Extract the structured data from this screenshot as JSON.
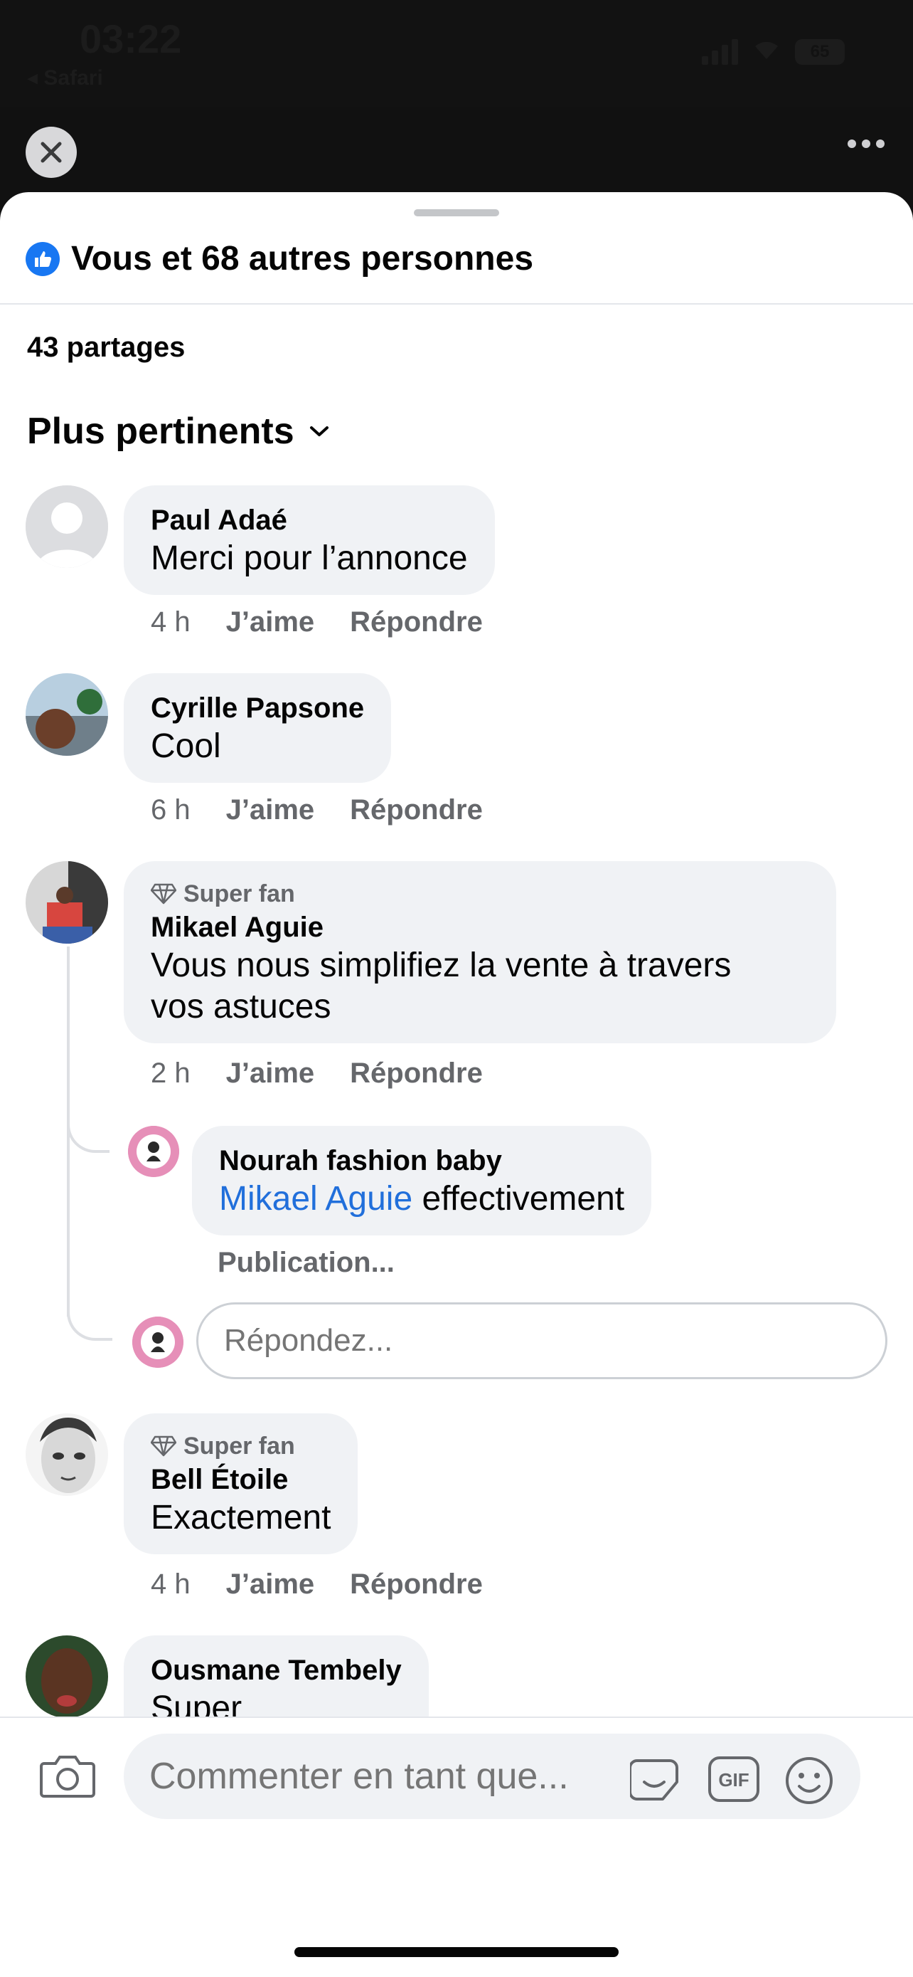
{
  "status_bar": {
    "time": "03:22",
    "back_app": "◂ Safari",
    "battery": "65"
  },
  "header": {
    "close_icon": "close-icon",
    "more_icon": "more-icon"
  },
  "sheet": {
    "reactions": "Vous et 68 autres personnes",
    "shares": "43 partages",
    "sort": "Plus pertinents"
  },
  "comments": [
    {
      "author": "Paul Adaé",
      "text": "Merci pour l’annonce",
      "time": "4 h",
      "like": "J’aime",
      "reply": "Répondre"
    },
    {
      "author": "Cyrille Papsone",
      "text": "Cool",
      "time": "6 h",
      "like": "J’aime",
      "reply": "Répondre"
    },
    {
      "badge": "Super fan",
      "author": "Mikael Aguie",
      "text_line1": "Vous nous simplifiez la vente à travers",
      "text_line2": "vos astuces",
      "time": "2 h",
      "like": "J’aime",
      "reply": "Répondre",
      "reply_item": {
        "author": "Nourah fashion baby",
        "mention": "Mikael Aguie",
        "text": " effectivement",
        "status": "Publication..."
      },
      "reply_placeholder": "Répondez..."
    },
    {
      "badge": "Super fan",
      "author": "Bell Étoile",
      "text": "Exactement",
      "time": "4 h",
      "like": "J’aime",
      "reply": "Répondre"
    },
    {
      "author": "Ousmane Tembely",
      "text": "Super"
    }
  ],
  "composer": {
    "placeholder": "Commenter en tant que...",
    "gif_label": "GIF"
  },
  "colors": {
    "accent": "#1877f2",
    "mention": "#216fdb",
    "bubble": "#f0f2f5",
    "meta": "#65676b"
  }
}
